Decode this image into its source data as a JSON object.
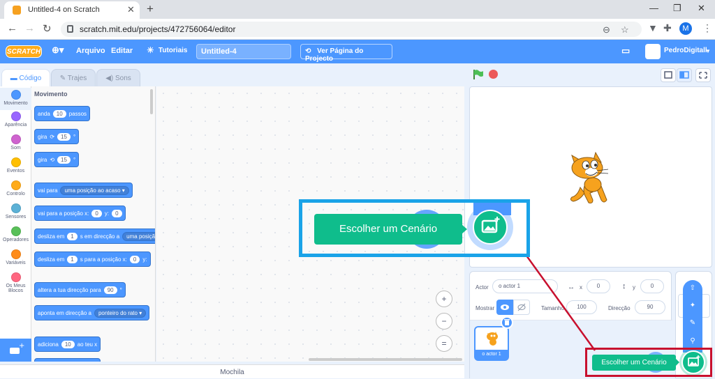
{
  "browser": {
    "tab_title": "Untitled-4 on Scratch",
    "tab_close": "✕",
    "new_tab": "+",
    "url": "scratch.mit.edu/projects/472756064/editor",
    "profile_initial": "M",
    "window_controls": [
      "—",
      "❐",
      "✕"
    ]
  },
  "menubar": {
    "logo": "SCRATCH",
    "items": [
      "Arquivo",
      "Editar"
    ],
    "tutorials": "Tutoriais",
    "project_title": "Untitled-4",
    "see_project": "Ver Página do Projecto",
    "username": "PedroDigitall",
    "accent_color": "#4c97ff"
  },
  "editor_tabs": [
    {
      "label": "Código",
      "active": true
    },
    {
      "label": "Trajes",
      "active": false
    },
    {
      "label": "Sons",
      "active": false
    }
  ],
  "categories": [
    {
      "label": "Movimento",
      "color": "#4c97ff"
    },
    {
      "label": "Aparência",
      "color": "#9966ff"
    },
    {
      "label": "Som",
      "color": "#cf63cf"
    },
    {
      "label": "Eventos",
      "color": "#ffbf00"
    },
    {
      "label": "Controlo",
      "color": "#ffab19"
    },
    {
      "label": "Sensores",
      "color": "#5cb1d6"
    },
    {
      "label": "Operadores",
      "color": "#59c059"
    },
    {
      "label": "Variáveis",
      "color": "#ff8c1a"
    },
    {
      "label": "Os Meus Blocos",
      "color": "#ff6680"
    }
  ],
  "palette": {
    "title": "Movimento",
    "blocks": {
      "move": {
        "pre": "anda",
        "value": "10",
        "post": "passos"
      },
      "turn_right": {
        "pre": "gira",
        "icon": "⟳",
        "value": "15",
        "post": "°"
      },
      "turn_left": {
        "pre": "gira",
        "icon": "⟲",
        "value": "15",
        "post": "°"
      },
      "goto": {
        "pre": "vai para",
        "dropdown": "uma posição ao acaso ▾"
      },
      "goto_xy": {
        "pre": "vai para a posição x:",
        "x": "0",
        "mid": "y:",
        "y": "0"
      },
      "glide_to": {
        "pre": "desliza em",
        "value": "1",
        "mid": "s em direcção a",
        "dropdown": "uma posiçã"
      },
      "glide_xy": {
        "pre": "desliza em",
        "value": "1",
        "mid": "s para a posição x:",
        "x": "0",
        "tail": "y:"
      },
      "point_dir": {
        "pre": "altera a tua direcção para",
        "value": "90",
        "post": "°"
      },
      "point_towards": {
        "pre": "aponta em direcção a",
        "dropdown": "ponteiro do rato ▾"
      },
      "change_x": {
        "pre": "adiciona",
        "value": "10",
        "post": "ao teu x"
      }
    }
  },
  "zoom": {
    "in": "+",
    "out": "−",
    "reset": "="
  },
  "backpack": "Mochila",
  "sprite_info": {
    "actor_label": "Actor",
    "actor_name": "o actor 1",
    "x_label": "x",
    "x": "0",
    "y_label": "y",
    "y": "0",
    "show_label": "Mostrar",
    "size_label": "Tamanho",
    "size": "100",
    "direction_label": "Direcção",
    "direction": "90"
  },
  "sprite_list": {
    "sprite_name": "o actor 1"
  },
  "callout": {
    "tooltip": "Escolher um Cenário"
  },
  "highlight": {
    "tooltip": "Escolher um Cenário"
  }
}
